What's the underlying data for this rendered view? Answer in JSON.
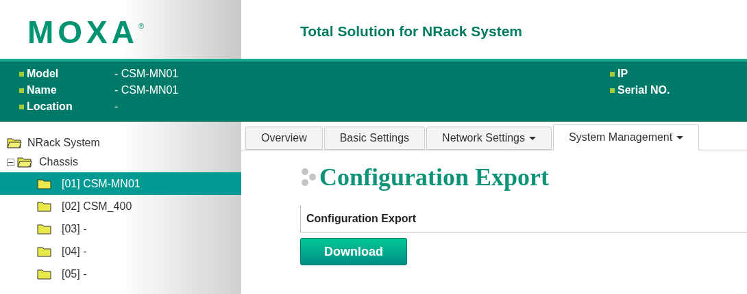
{
  "header": {
    "logo": "MOXA",
    "logo_mark": "®",
    "title": "Total Solution for NRack System"
  },
  "info_left": [
    {
      "label": "Model",
      "value": "- CSM-MN01"
    },
    {
      "label": "Name",
      "value": "- CSM-MN01"
    },
    {
      "label": "Location",
      "value": "-"
    }
  ],
  "info_right": [
    {
      "label": "IP"
    },
    {
      "label": "Serial NO."
    }
  ],
  "tree": {
    "label": "NRack System",
    "children": [
      {
        "label": "Chassis",
        "expanded": true,
        "children": [
          {
            "label": "[01] CSM-MN01",
            "selected": true
          },
          {
            "label": "[02] CSM_400",
            "selected": false
          },
          {
            "label": "[03] -",
            "selected": false
          },
          {
            "label": "[04] -",
            "selected": false
          },
          {
            "label": "[05] -",
            "selected": false
          }
        ]
      }
    ]
  },
  "tabs": [
    {
      "label": "Overview",
      "dropdown": false,
      "selected": false
    },
    {
      "label": "Basic Settings",
      "dropdown": false,
      "selected": false
    },
    {
      "label": "Network Settings",
      "dropdown": true,
      "selected": false
    },
    {
      "label": "System Management",
      "dropdown": true,
      "selected": true
    }
  ],
  "page_title": "Configuration Export",
  "section_title": "Configuration Export",
  "buttons": [
    "Download"
  ]
}
